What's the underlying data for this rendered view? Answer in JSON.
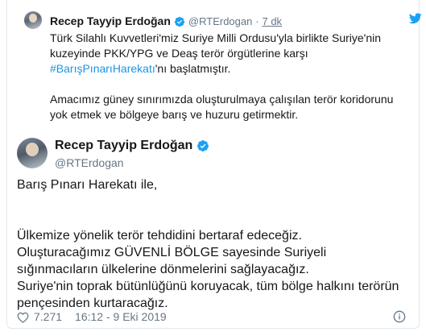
{
  "quoted_tweet": {
    "author_name": "Recep Tayyip Erdoğan",
    "handle": "@RTErdogan",
    "separator": "·",
    "time": "7 dk",
    "paragraph1_lines": [
      "Türk Silahlı Kuvvetleri'miz Suriye Milli Ordusu'yla birlikte Suriye'nin",
      "kuzeyinde PKK/YPG ve Deaş terör örgütlerine karşı"
    ],
    "hashtag": "#BarışPınarıHarekatı",
    "hashtag_suffix": "'nı başlatmıştır.",
    "paragraph2_lines": [
      "Amacımız güney sınırımızda oluşturulmaya çalışılan terör koridorunu",
      "yok etmek ve bölgeye barış ve huzuru getirmektir."
    ]
  },
  "main_tweet": {
    "author_name": "Recep Tayyip Erdoğan",
    "handle": "@RTErdogan",
    "line1": "Barış Pınarı Harekatı ile,",
    "lines": [
      "Ülkemize yönelik terör tehdidini bertaraf edeceğiz.",
      "Oluşturacağımız GÜVENLİ BÖLGE sayesinde Suriyeli",
      "sığınmacıların ülkelerine dönmelerini sağlayacağız.",
      "Suriye'nin toprak bütünlüğünü koruyacak, tüm bölge halkını terörün",
      "pençesinden kurtaracağız."
    ]
  },
  "footer": {
    "like_count": "7.271",
    "timestamp": "16:12 - 9 Eki 2019"
  },
  "icons": {
    "verified": "verified-badge-icon",
    "bird": "twitter-bird-icon",
    "heart": "heart-icon",
    "info": "info-icon"
  },
  "colors": {
    "brand_blue": "#1da1f2",
    "hashtag": "#1b95e0",
    "muted": "#657786",
    "text": "#14171a",
    "border": "#e1e8ed"
  }
}
